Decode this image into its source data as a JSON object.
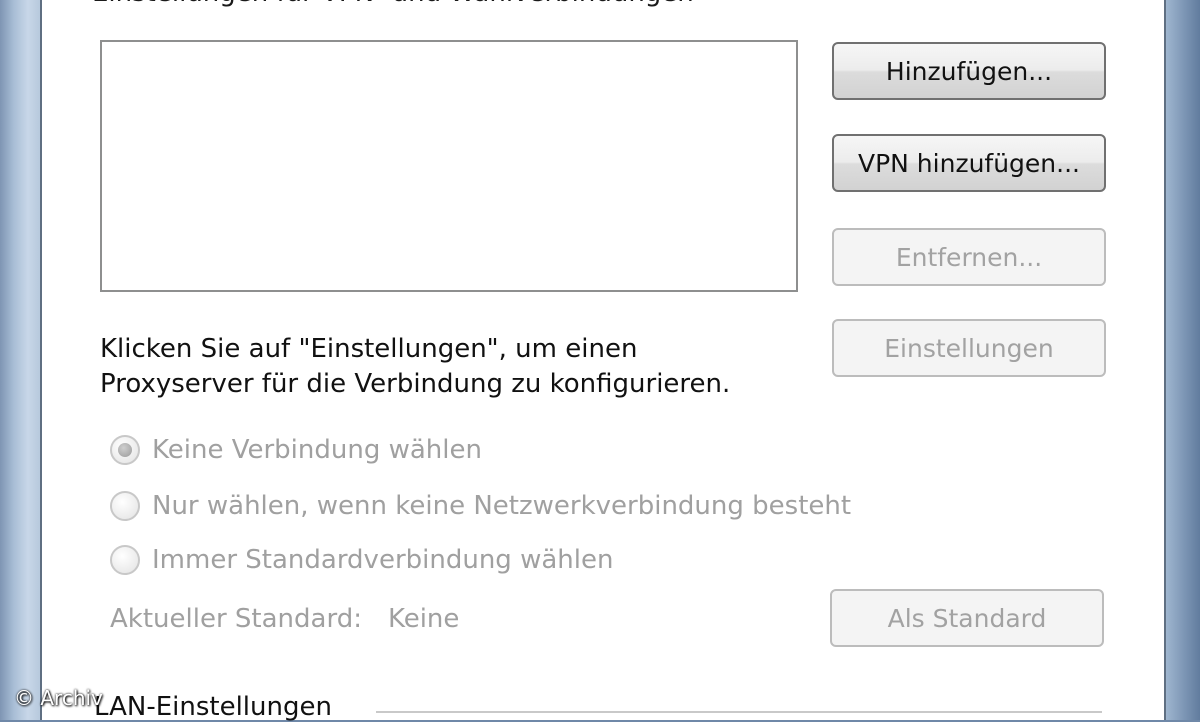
{
  "dialog": {
    "group_title": "Einstellungen für VPN- und Wählverbindungen"
  },
  "buttons": {
    "add": "Hinzufügen...",
    "add_vpn": "VPN hinzufügen...",
    "remove": "Entfernen...",
    "settings": "Einstellungen",
    "set_default": "Als Standard"
  },
  "description": {
    "line1": "Klicken Sie auf \"Einstellungen\", um einen",
    "line2": "Proxyserver für die Verbindung zu konfigurieren."
  },
  "radios": [
    {
      "label": "Keine Verbindung wählen",
      "checked": true
    },
    {
      "label": "Nur wählen, wenn keine Netzwerkverbindung besteht",
      "checked": false
    },
    {
      "label": "Immer Standardverbindung wählen",
      "checked": false
    }
  ],
  "current_default": {
    "label": "Aktueller Standard:",
    "value": "Keine"
  },
  "lan": {
    "title": "LAN-Einstellungen"
  },
  "watermark": "© Archiv"
}
